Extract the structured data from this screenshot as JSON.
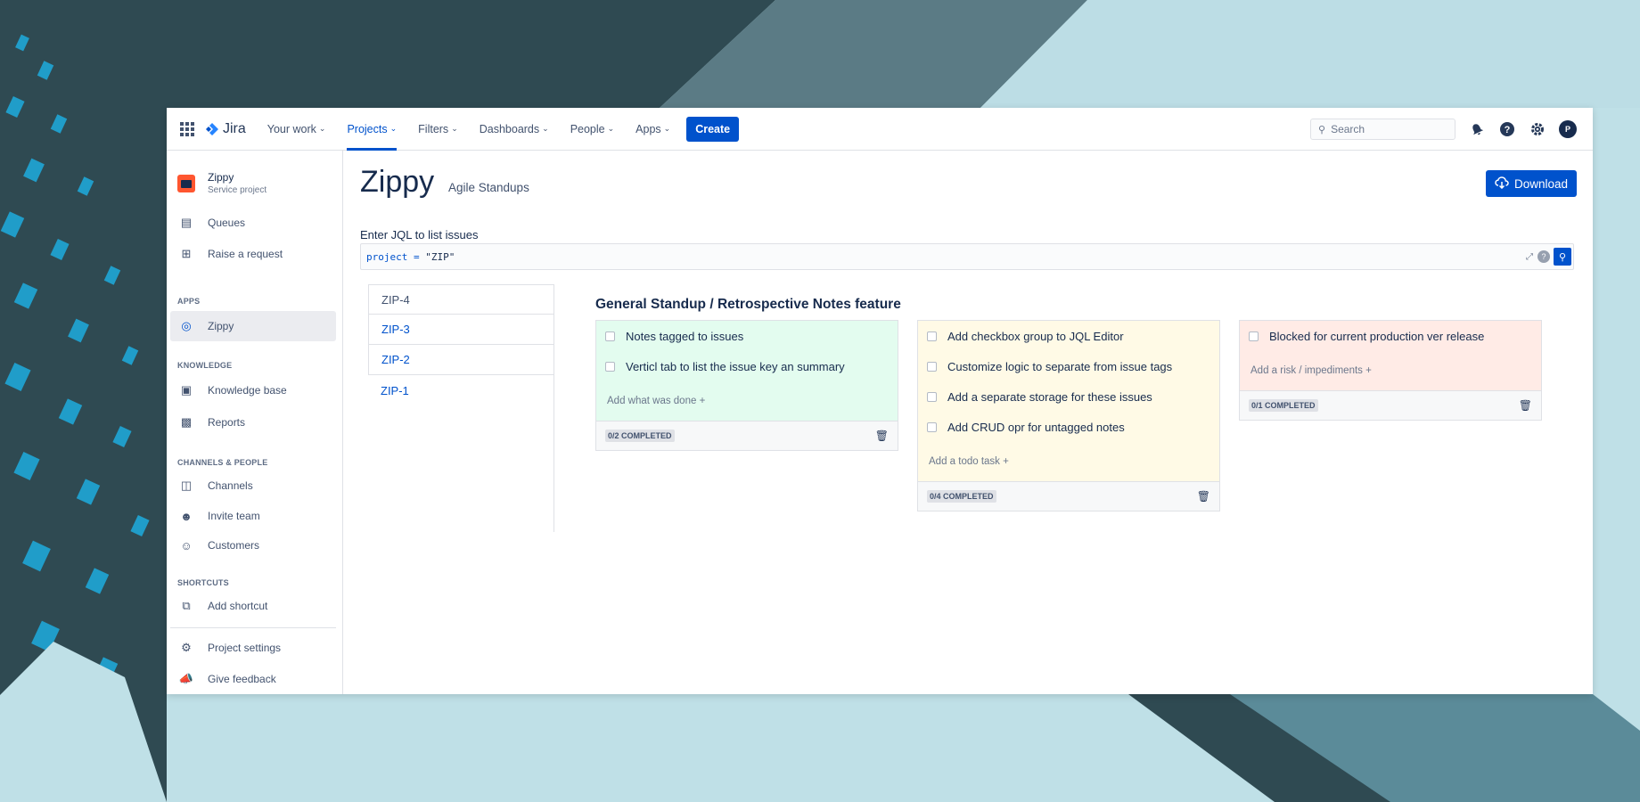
{
  "nav": {
    "logo": "Jira",
    "items": [
      {
        "label": "Your work"
      },
      {
        "label": "Projects"
      },
      {
        "label": "Filters"
      },
      {
        "label": "Dashboards"
      },
      {
        "label": "People"
      },
      {
        "label": "Apps"
      }
    ],
    "create": "Create",
    "search_placeholder": "Search",
    "avatar_initial": "P"
  },
  "sidebar": {
    "project_name": "Zippy",
    "project_type": "Service project",
    "queues": "Queues",
    "raise": "Raise a request",
    "apps_head": "APPS",
    "app_zippy": "Zippy",
    "knowledge_head": "KNOWLEDGE",
    "kb": "Knowledge base",
    "reports": "Reports",
    "channels_head": "CHANNELS & PEOPLE",
    "channels": "Channels",
    "invite": "Invite team",
    "customers": "Customers",
    "shortcuts_head": "SHORTCUTS",
    "add_shortcut": "Add shortcut",
    "settings": "Project settings",
    "feedback": "Give feedback"
  },
  "main": {
    "title": "Zippy",
    "subtitle": "Agile Standups",
    "download": "Download",
    "jql_label": "Enter JQL to list issues",
    "jql_keyword": "project = ",
    "jql_value": "\"ZIP\"",
    "issues": [
      "ZIP-4",
      "ZIP-3",
      "ZIP-2",
      "ZIP-1"
    ],
    "board_title": "General Standup / Retrospective Notes feature",
    "done": {
      "tasks": [
        "Notes tagged to issues",
        "Verticl tab to list the issue key an summary"
      ],
      "add": "Add what was done +",
      "status": "0/2 COMPLETED"
    },
    "todo": {
      "tasks": [
        "Add checkbox group to JQL Editor",
        "Customize logic to separate from issue tags",
        "Add a separate storage for these issues",
        "Add CRUD opr for untagged notes"
      ],
      "add": "Add a todo task +",
      "status": "0/4 COMPLETED"
    },
    "risk": {
      "tasks": [
        "Blocked for current production ver release"
      ],
      "add": "Add a risk / impediments +",
      "status": "0/1 COMPLETED"
    }
  },
  "colors": {
    "accent": "#0052cc",
    "done_bg": "#e3fcef",
    "todo_bg": "#fffae6",
    "risk_bg": "#ffebe6"
  }
}
